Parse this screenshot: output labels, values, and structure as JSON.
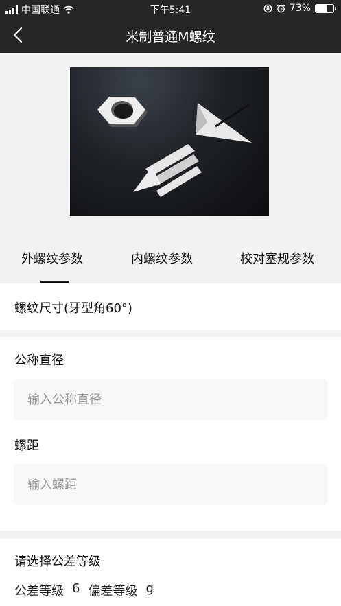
{
  "status_bar": {
    "carrier": "中国联通",
    "time": "下午5:41",
    "battery_pct": "73%",
    "battery_level": 0.73
  },
  "nav": {
    "title": "米制普通M螺纹",
    "back_icon": "chevron-left-icon"
  },
  "hero": {
    "image_subject": "nut-and-screw-illustration"
  },
  "tabs": [
    {
      "label": "外螺纹参数",
      "active": true
    },
    {
      "label": "内螺纹参数",
      "active": false
    },
    {
      "label": "校对塞规参数",
      "active": false
    }
  ],
  "thread_section": {
    "title": "螺纹尺寸(牙型角60°)"
  },
  "form": {
    "diameter_label": "公称直径",
    "diameter_placeholder": "输入公称直径",
    "diameter_value": "",
    "pitch_label": "螺距",
    "pitch_placeholder": "输入螺距",
    "pitch_value": ""
  },
  "tolerance": {
    "title": "请选择公差等级",
    "grade_label": "公差等级",
    "grade_value": "6",
    "deviation_label": "偏差等级",
    "deviation_value": "g"
  },
  "colors": {
    "bar_background": "#262626",
    "page_background": "#f2f2f2",
    "input_background": "#f7f7f9",
    "tab_indicator": "#111111"
  }
}
